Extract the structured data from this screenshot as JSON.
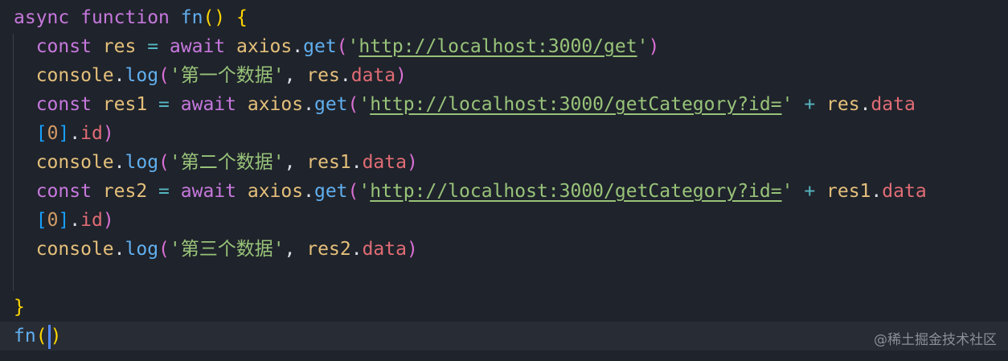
{
  "editor": {
    "lines": [
      [
        [
          "kw",
          "async"
        ],
        [
          "t",
          " "
        ],
        [
          "kw",
          "function"
        ],
        [
          "t",
          " "
        ],
        [
          "fnc",
          "fn"
        ],
        [
          "br1",
          "()"
        ],
        [
          "t",
          " "
        ],
        [
          "br1",
          "{"
        ]
      ],
      [
        [
          "t",
          "  "
        ],
        [
          "kw",
          "const"
        ],
        [
          "pl",
          " res "
        ],
        [
          "op",
          "="
        ],
        [
          "t",
          " "
        ],
        [
          "kw",
          "await"
        ],
        [
          "pl",
          " axios"
        ],
        [
          "t",
          "."
        ],
        [
          "fnc",
          "get"
        ],
        [
          "br2",
          "("
        ],
        [
          "str",
          "'"
        ],
        [
          "url",
          "http://localhost:3000/get"
        ],
        [
          "str",
          "'"
        ],
        [
          "br2",
          ")"
        ]
      ],
      [
        [
          "t",
          "  "
        ],
        [
          "pl",
          "console"
        ],
        [
          "t",
          "."
        ],
        [
          "fnc",
          "log"
        ],
        [
          "br2",
          "("
        ],
        [
          "str",
          "'第一个数据'"
        ],
        [
          "t",
          ", "
        ],
        [
          "pl",
          "res"
        ],
        [
          "t",
          "."
        ],
        [
          "prp",
          "data"
        ],
        [
          "br2",
          ")"
        ]
      ],
      [
        [
          "t",
          "  "
        ],
        [
          "kw",
          "const"
        ],
        [
          "pl",
          " res1 "
        ],
        [
          "op",
          "="
        ],
        [
          "t",
          " "
        ],
        [
          "kw",
          "await"
        ],
        [
          "pl",
          " axios"
        ],
        [
          "t",
          "."
        ],
        [
          "fnc",
          "get"
        ],
        [
          "br2",
          "("
        ],
        [
          "str",
          "'"
        ],
        [
          "url",
          "http://localhost:3000/getCategory?id="
        ],
        [
          "str",
          "'"
        ],
        [
          "t",
          " "
        ],
        [
          "op",
          "+"
        ],
        [
          "pl",
          " res"
        ],
        [
          "t",
          "."
        ],
        [
          "prp",
          "data"
        ]
      ],
      [
        [
          "t",
          "  "
        ],
        [
          "br3",
          "["
        ],
        [
          "num",
          "0"
        ],
        [
          "br3",
          "]"
        ],
        [
          "t",
          "."
        ],
        [
          "prp",
          "id"
        ],
        [
          "br2",
          ")"
        ]
      ],
      [
        [
          "t",
          "  "
        ],
        [
          "pl",
          "console"
        ],
        [
          "t",
          "."
        ],
        [
          "fnc",
          "log"
        ],
        [
          "br2",
          "("
        ],
        [
          "str",
          "'第二个数据'"
        ],
        [
          "t",
          ", "
        ],
        [
          "pl",
          "res1"
        ],
        [
          "t",
          "."
        ],
        [
          "prp",
          "data"
        ],
        [
          "br2",
          ")"
        ]
      ],
      [
        [
          "t",
          "  "
        ],
        [
          "kw",
          "const"
        ],
        [
          "pl",
          " res2 "
        ],
        [
          "op",
          "="
        ],
        [
          "t",
          " "
        ],
        [
          "kw",
          "await"
        ],
        [
          "pl",
          " axios"
        ],
        [
          "t",
          "."
        ],
        [
          "fnc",
          "get"
        ],
        [
          "br2",
          "("
        ],
        [
          "str",
          "'"
        ],
        [
          "url",
          "http://localhost:3000/getCategory?id="
        ],
        [
          "str",
          "'"
        ],
        [
          "t",
          " "
        ],
        [
          "op",
          "+"
        ],
        [
          "pl",
          " res1"
        ],
        [
          "t",
          "."
        ],
        [
          "prp",
          "data"
        ]
      ],
      [
        [
          "t",
          "  "
        ],
        [
          "br3",
          "["
        ],
        [
          "num",
          "0"
        ],
        [
          "br3",
          "]"
        ],
        [
          "t",
          "."
        ],
        [
          "prp",
          "id"
        ],
        [
          "br2",
          ")"
        ]
      ],
      [
        [
          "t",
          "  "
        ],
        [
          "pl",
          "console"
        ],
        [
          "t",
          "."
        ],
        [
          "fnc",
          "log"
        ],
        [
          "br2",
          "("
        ],
        [
          "str",
          "'第三个数据'"
        ],
        [
          "t",
          ", "
        ],
        [
          "pl",
          "res2"
        ],
        [
          "t",
          "."
        ],
        [
          "prp",
          "data"
        ],
        [
          "br2",
          ")"
        ]
      ],
      [
        [
          "t",
          ""
        ]
      ],
      [
        [
          "br1",
          "}"
        ]
      ]
    ],
    "current_line": [
      [
        "fnc",
        "fn"
      ],
      [
        "br1",
        "("
      ],
      [
        "cursor",
        ""
      ],
      [
        "br1",
        ")"
      ]
    ]
  },
  "watermark": "@稀土掘金技术社区",
  "colors": {
    "background": "#1f232b",
    "current_line": "#282c34",
    "keyword": "#c678dd",
    "function": "#61afef",
    "variable": "#e5c07b",
    "property": "#e06c75",
    "string": "#98c379",
    "number": "#d19a66",
    "operator": "#56b6c2",
    "cursor": "#528bff"
  }
}
